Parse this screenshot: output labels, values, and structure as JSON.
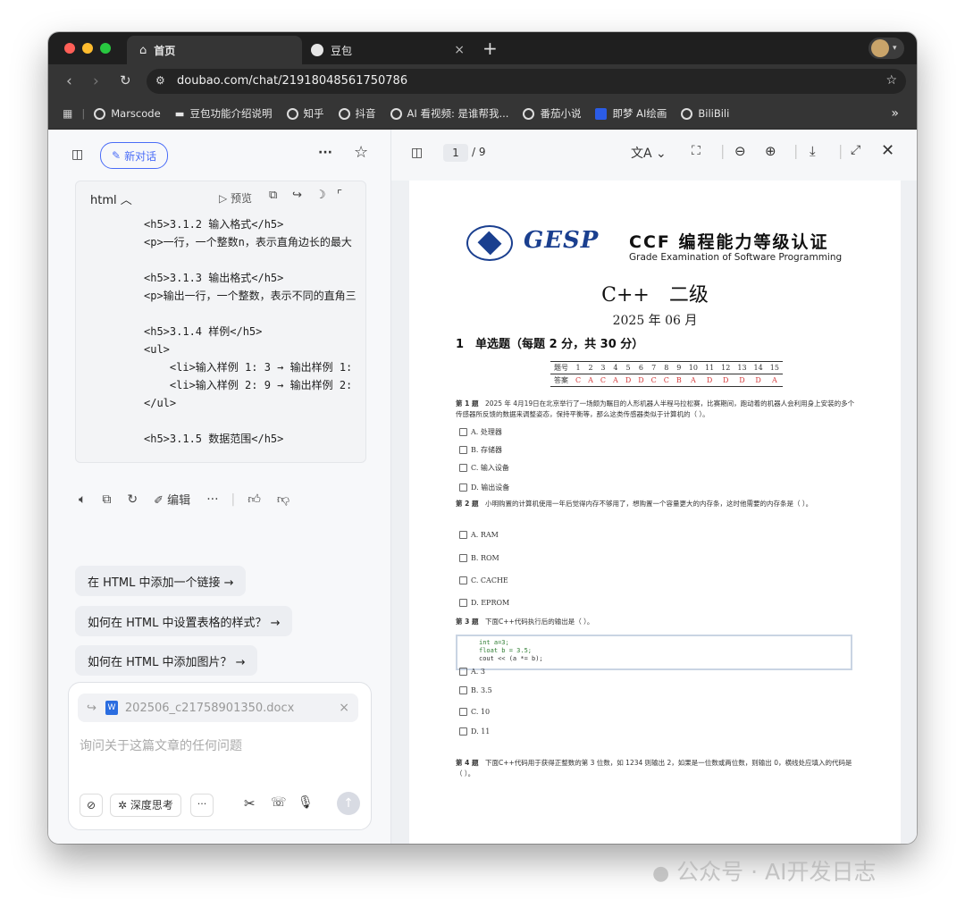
{
  "browser": {
    "tabs": [
      {
        "label": "首页",
        "icon": "home-icon"
      },
      {
        "label": "豆包",
        "icon": "doubao-icon"
      }
    ],
    "close_glyph": "×",
    "new_tab_glyph": "+",
    "url": "doubao.com/chat/21918048561750786",
    "bookmarks": [
      {
        "label": "Marscode"
      },
      {
        "label": "豆包功能介绍说明"
      },
      {
        "label": "知乎"
      },
      {
        "label": "抖音"
      },
      {
        "label": "AI 看视频: 是谁帮我..."
      },
      {
        "label": "番茄小说"
      },
      {
        "label": "即梦 AI绘画"
      },
      {
        "label": "BiliBili"
      }
    ],
    "more_glyph": "»"
  },
  "chat": {
    "new_chat_label": "新对话",
    "more_glyph": "···",
    "code_card": {
      "lang_label": "html",
      "preview_label": "预览",
      "lines": [
        "<h5>3.1.2 输入格式</h5>",
        "<p>一行，一个整数n，表示直角边长的最大",
        "",
        "<h5>3.1.3 输出格式</h5>",
        "<p>输出一行，一个整数，表示不同的直角三",
        "",
        "<h5>3.1.4 样例</h5>",
        "<ul>",
        "    <li>输入样例 1: 3 → 输出样例 1:",
        "    <li>输入样例 2: 9 → 输出样例 2:",
        "</ul>",
        "",
        "<h5>3.1.5 数据范围</h5>"
      ]
    },
    "edit_label": "编辑",
    "suggestions": [
      "在 HTML 中添加一个链接 →",
      "如何在 HTML 中设置表格的样式？ →",
      "如何在 HTML 中添加图片？ →"
    ],
    "attachment_name": "202506_c21758901350.docx",
    "input_placeholder": "询问关于这篇文章的任何问题",
    "deep_think_label": "深度思考"
  },
  "viewer": {
    "page_current": "1",
    "page_total": "/ 9"
  },
  "pdf": {
    "logo_text": "GESP",
    "title": "CCF 编程能力等级认证",
    "subtitle": "Grade Examination of Software Programming",
    "level": "C++　二级",
    "date": "2025 年 06 月",
    "section": "1　单选题（每题 2 分，共 30 分）",
    "answer_table": {
      "header_label": "题号",
      "numbers": [
        "1",
        "2",
        "3",
        "4",
        "5",
        "6",
        "7",
        "8",
        "9",
        "10",
        "11",
        "12",
        "13",
        "14",
        "15"
      ],
      "answer_label": "答案",
      "answers": [
        "C",
        "A",
        "C",
        "A",
        "D",
        "D",
        "C",
        "C",
        "B",
        "A",
        "D",
        "D",
        "D",
        "D",
        "A"
      ]
    },
    "q1": {
      "num": "第 1 题",
      "text": "2025 年 4月19日在北京举行了一场颇为瞩目的人形机器人半程马拉松赛，比赛期间，跑动着的机器人会利用身上安装的多个传感器所反馈的数据来调整姿态，保持平衡等，那么这类传感器类似于计算机的（ ）。",
      "options": [
        "A. 处理器",
        "B. 存储器",
        "C. 输入设备",
        "D. 输出设备"
      ]
    },
    "q2": {
      "num": "第 2 题",
      "text": "小明购置的计算机使用一年后觉得内存不够用了，想购置一个容量更大的内存条，这时他需要的内存条是（ ）。",
      "options": [
        "A. RAM",
        "B. ROM",
        "C. CACHE",
        "D. EPROM"
      ]
    },
    "q3": {
      "num": "第 3 题",
      "text": "下面C++代码执行后的输出是（ ）。",
      "code": [
        "int a=3;",
        "float b = 3.5;",
        "cout << (a *= b);"
      ],
      "options": [
        "A. 3",
        "B. 3.5",
        "C. 10",
        "D. 11"
      ]
    },
    "q4": {
      "num": "第 4 题",
      "text": "下面C++代码用于获得正整数的第 3 位数，如 1234 则输出 2，如果是一位数或两位数，则输出 0，横线处应填入的代码是（ ）。"
    }
  },
  "watermark": "公众号 · AI开发日志",
  "colors": {
    "accent_blue": "#4a6cf7",
    "gesp_blue": "#1a3f8f",
    "answer_red": "#d33a3a"
  }
}
